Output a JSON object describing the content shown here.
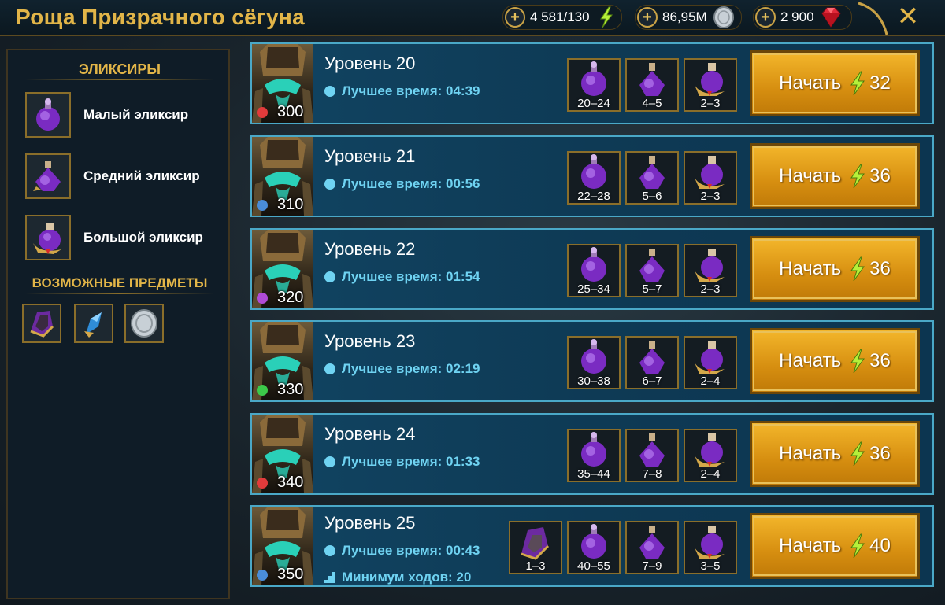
{
  "header": {
    "title": "Роща Призрачного сёгуна",
    "energy": "4 581/130",
    "silver": "86,95M",
    "gems": "2 900"
  },
  "sidebar": {
    "elixirs_title": "ЭЛИКСИРЫ",
    "elixirs": [
      {
        "label": "Малый эликсир"
      },
      {
        "label": "Средний эликсир"
      },
      {
        "label": "Большой эликсир"
      }
    ],
    "possible_title": "ВОЗМОЖНЫЕ ПРЕДМЕТЫ"
  },
  "best_time_label": "Лучшее время: ",
  "start_label": "Начать",
  "levels": [
    {
      "title": "Уровень 20",
      "best_time": "04:39",
      "power": "300",
      "faction_color": "#e23b3b",
      "drops": [
        "20–24",
        "4–5",
        "2–3"
      ],
      "cost": "32"
    },
    {
      "title": "Уровень 21",
      "best_time": "00:56",
      "power": "310",
      "faction_color": "#4a8cd8",
      "drops": [
        "22–28",
        "5–6",
        "2–3"
      ],
      "cost": "36"
    },
    {
      "title": "Уровень 22",
      "best_time": "01:54",
      "power": "320",
      "faction_color": "#b04bd6",
      "drops": [
        "25–34",
        "5–7",
        "2–3"
      ],
      "cost": "36"
    },
    {
      "title": "Уровень 23",
      "best_time": "02:19",
      "power": "330",
      "faction_color": "#3cc94a",
      "drops": [
        "30–38",
        "6–7",
        "2–4"
      ],
      "cost": "36"
    },
    {
      "title": "Уровень 24",
      "best_time": "01:33",
      "power": "340",
      "faction_color": "#e23b3b",
      "drops": [
        "35–44",
        "7–8",
        "2–4"
      ],
      "cost": "36"
    },
    {
      "title": "Уровень 25",
      "best_time": "00:43",
      "min_moves": "Минимум ходов: 20",
      "power": "350",
      "faction_color": "#4a8cd8",
      "extra_drop": "1–3",
      "drops": [
        "40–55",
        "7–9",
        "3–5"
      ],
      "cost": "40"
    }
  ],
  "colors": {
    "accent_gold": "#e2b548",
    "row_border": "#4aa8c7",
    "best_time_text": "#6fd3f2",
    "start_button": "#e8a01c"
  },
  "icons": [
    "plus-icon",
    "lightning-icon",
    "silver-coin-icon",
    "ruby-icon",
    "close-icon",
    "clock-icon",
    "stairs-icon",
    "elixir-small-icon",
    "elixir-medium-icon",
    "elixir-large-icon",
    "artifact-helmet-icon",
    "artifact-gem-icon",
    "silver-icon"
  ]
}
